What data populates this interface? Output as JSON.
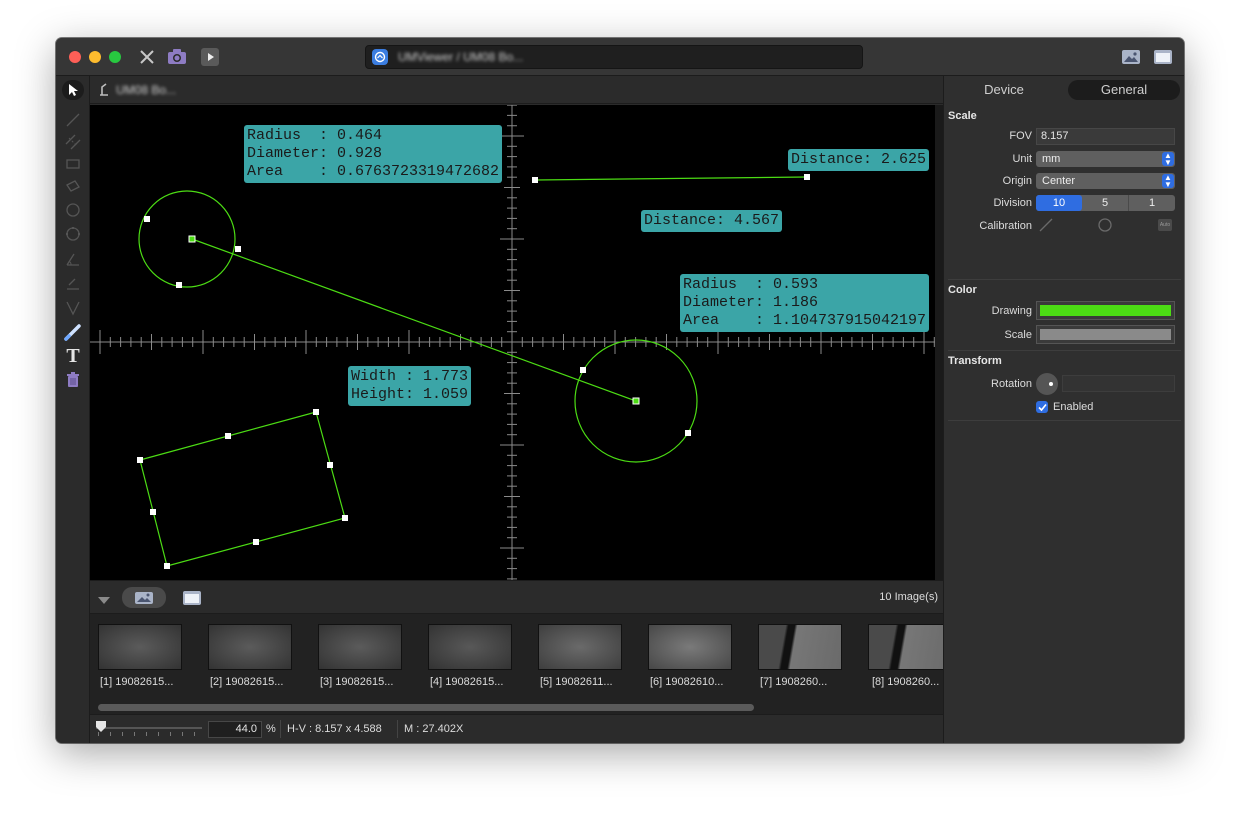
{
  "window": {
    "title": "UMViewer / UM08 Bo..."
  },
  "canvas": {
    "header_title": "UM08 Bo...",
    "labels": {
      "circle1": "Radius  : 0.464\nDiameter: 0.928\nArea    : 0.6763723319472682",
      "distance1": "Distance: 2.625",
      "distance2": "Distance: 4.567",
      "circle2": "Radius  : 0.593\nDiameter: 1.186\nArea    : 1.104737915042197",
      "rect": "Width : 1.773\nHeight: 1.059"
    },
    "drawing_color": "#4cdc14"
  },
  "strip": {
    "count_text": "10 Image(s)",
    "thumbnails": [
      {
        "caption": "[1] 19082615..."
      },
      {
        "caption": "[2] 19082615..."
      },
      {
        "caption": "[3] 19082615..."
      },
      {
        "caption": "[4] 19082615..."
      },
      {
        "caption": "[5] 19082611..."
      },
      {
        "caption": "[6] 19082610..."
      },
      {
        "caption": "[7] 1908260..."
      },
      {
        "caption": "[8] 1908260..."
      }
    ]
  },
  "status": {
    "zoom_value": "44.0",
    "zoom_unit": "%",
    "hv": "H-V : 8.157 x 4.588",
    "magnification": "M : 27.402X"
  },
  "panel": {
    "tabs": [
      "Device",
      "General"
    ],
    "active_tab": "General",
    "scale": {
      "title": "Scale",
      "fov_label": "FOV",
      "fov_value": "8.157",
      "unit_label": "Unit",
      "unit_value": "mm",
      "origin_label": "Origin",
      "origin_value": "Center",
      "division_label": "Division",
      "division_options": [
        "10",
        "5",
        "1"
      ],
      "division_selected": "10",
      "calibration_label": "Calibration",
      "calibration_auto": "Auto"
    },
    "color": {
      "title": "Color",
      "drawing_label": "Drawing",
      "drawing_color": "#4cdc14",
      "scale_label": "Scale",
      "scale_color": "#8a8a8a"
    },
    "transform": {
      "title": "Transform",
      "rotation_label": "Rotation",
      "enabled_label": "Enabled",
      "enabled": true
    }
  }
}
